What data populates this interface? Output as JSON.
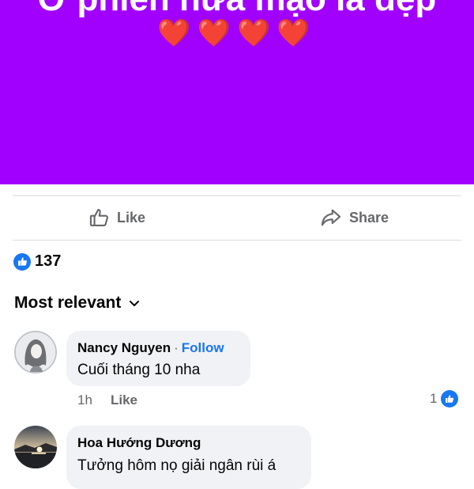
{
  "banner": {
    "text": "Ơ phiền hưa mạo là đẹp",
    "hearts": "❤️❤️❤️❤️",
    "background": "#a100ff"
  },
  "actions": {
    "like_label": "Like",
    "share_label": "Share"
  },
  "reactions": {
    "count": "137",
    "icon": "thumbs-up-icon"
  },
  "comments_sort": {
    "label": "Most relevant",
    "icon": "chevron-down-icon"
  },
  "comments": [
    {
      "author": "Nancy Nguyen",
      "separator": "·",
      "follow_label": "Follow",
      "text": "Cuối tháng 10 nha",
      "time": "1h",
      "like_label": "Like",
      "reaction_count": "1"
    },
    {
      "author": "Hoa Hướng Dương",
      "text": "Tưởng hôm nọ giải ngân rùi á"
    }
  ],
  "colors": {
    "accent": "#1877f2",
    "secondary_text": "#65676b",
    "bubble": "#f0f2f5"
  }
}
